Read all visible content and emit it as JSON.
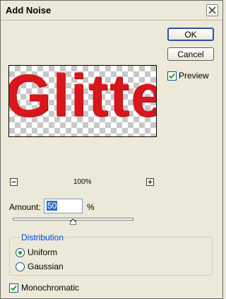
{
  "window": {
    "title": "Add Noise"
  },
  "buttons": {
    "ok": "OK",
    "cancel": "Cancel"
  },
  "preview": {
    "label": "Preview",
    "checked": true,
    "sample_text": "Glitte",
    "text_color": "#d9161c"
  },
  "zoom": {
    "level": "100%",
    "minus_symbol": "−",
    "plus_symbol": "+"
  },
  "amount": {
    "label": "Amount:",
    "value": "50",
    "unit": "%",
    "slider_fraction": 0.5
  },
  "distribution": {
    "label": "Distribution",
    "options": [
      {
        "label": "Uniform",
        "selected": true
      },
      {
        "label": "Gaussian",
        "selected": false
      }
    ]
  },
  "monochromatic": {
    "label": "Monochromatic",
    "checked": true
  },
  "colors": {
    "accent": "#0046d5",
    "check_green": "#21a121",
    "dialog_bg": "#ece9d8"
  }
}
